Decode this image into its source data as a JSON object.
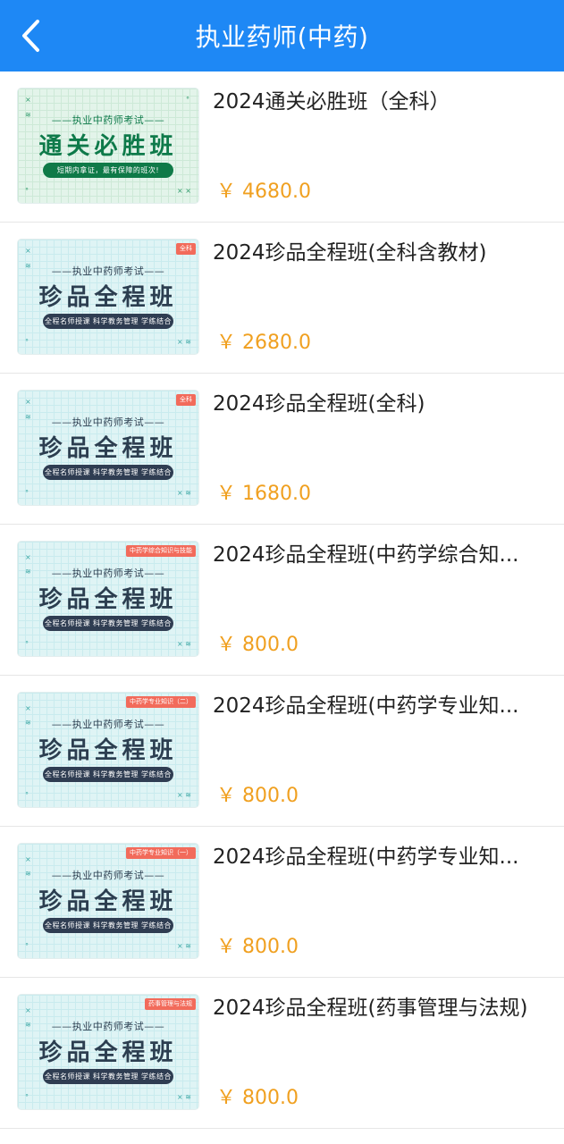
{
  "header": {
    "title": "执业药师(中药)",
    "back_icon": "chevron-left-icon"
  },
  "courses": [
    {
      "title": "2024通关必胜班（全科）",
      "price": "￥ 4680.0",
      "thumb": {
        "subtitle": "——执业中药师考试——",
        "main": "通关必胜班",
        "pill": "短期内拿证，最有保障的班次!",
        "tag": "",
        "theme": "green"
      }
    },
    {
      "title": "2024珍品全程班(全科含教材)",
      "price": "￥ 2680.0",
      "thumb": {
        "subtitle": "——执业中药师考试——",
        "main": "珍品全程班",
        "pill": "全程名师授课 科学教务管理 学练结合",
        "tag": "全科",
        "theme": "teal"
      }
    },
    {
      "title": "2024珍品全程班(全科)",
      "price": "￥ 1680.0",
      "thumb": {
        "subtitle": "——执业中药师考试——",
        "main": "珍品全程班",
        "pill": "全程名师授课 科学教务管理 学练结合",
        "tag": "全科",
        "theme": "teal"
      }
    },
    {
      "title": "2024珍品全程班(中药学综合知...",
      "price": "￥ 800.0",
      "thumb": {
        "subtitle": "——执业中药师考试——",
        "main": "珍品全程班",
        "pill": "全程名师授课 科学教务管理 学练结合",
        "tag": "中药学综合知识与技能",
        "theme": "teal"
      }
    },
    {
      "title": "2024珍品全程班(中药学专业知...",
      "price": "￥ 800.0",
      "thumb": {
        "subtitle": "——执业中药师考试——",
        "main": "珍品全程班",
        "pill": "全程名师授课 科学教务管理 学练结合",
        "tag": "中药学专业知识（二）",
        "theme": "teal"
      }
    },
    {
      "title": "2024珍品全程班(中药学专业知...",
      "price": "￥ 800.0",
      "thumb": {
        "subtitle": "——执业中药师考试——",
        "main": "珍品全程班",
        "pill": "全程名师授课 科学教务管理 学练结合",
        "tag": "中药学专业知识（一）",
        "theme": "teal"
      }
    },
    {
      "title": "2024珍品全程班(药事管理与法规)",
      "price": "￥ 800.0",
      "thumb": {
        "subtitle": "——执业中药师考试——",
        "main": "珍品全程班",
        "pill": "全程名师授课 科学教务管理 学练结合",
        "tag": "药事管理与法规",
        "theme": "teal"
      }
    }
  ]
}
